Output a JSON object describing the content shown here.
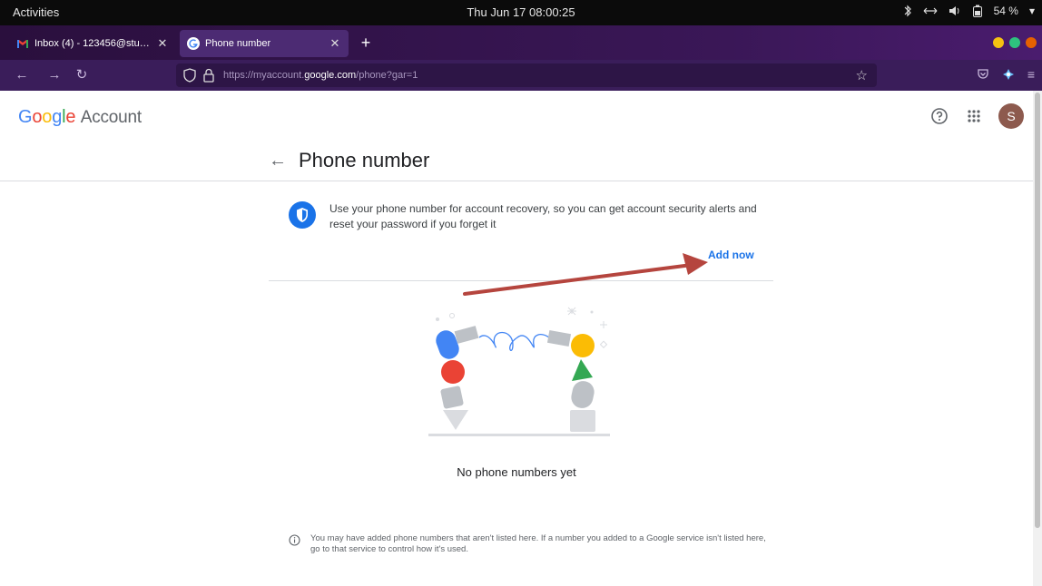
{
  "system_bar": {
    "activities": "Activities",
    "clock": "Thu Jun 17  08:00:25",
    "battery": "54 %"
  },
  "browser": {
    "tabs": [
      {
        "title": "Inbox (4) - 123456@student.e",
        "favicon": "gmail-icon",
        "active": false
      },
      {
        "title": "Phone number",
        "favicon": "google-icon",
        "active": true
      }
    ],
    "url_prefix": "https://myaccount.",
    "url_domain": "google.com",
    "url_path": "/phone?gar=1"
  },
  "header": {
    "logo_google": [
      "G",
      "o",
      "o",
      "g",
      "l",
      "e"
    ],
    "logo_account": "Account",
    "avatar_letter": "S"
  },
  "page": {
    "title": "Phone number",
    "info_text": "Use your phone number for account recovery, so you can get account security alerts and reset your password if you forget it",
    "add_now": "Add now",
    "empty_state": "No phone numbers yet",
    "footnote": "You may have added phone numbers that aren't listed here. If a number you added to a Google service isn't listed here, go to that service to control how it's used."
  },
  "colors": {
    "accent": "#1a73e8",
    "annotation_arrow": "#b5453e"
  }
}
